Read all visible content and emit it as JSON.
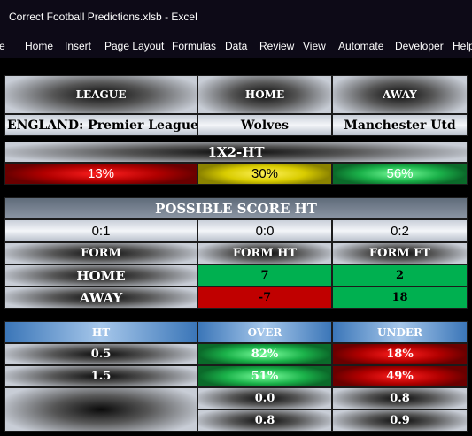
{
  "window": {
    "title": "Correct Football Predictions.xlsb  -  Excel"
  },
  "ribbon": {
    "tabs": [
      "e",
      "Home",
      "Insert",
      "Page Layout",
      "Formulas",
      "Data",
      "Review",
      "View",
      "Automate",
      "Developer",
      "Help"
    ]
  },
  "match": {
    "league_header": "LEAGUE",
    "home_header": "HOME",
    "away_header": "AWAY",
    "league": "ENGLAND: Premier League",
    "home_team": "Wolves",
    "away_team": "Manchester Utd"
  },
  "ht_1x2": {
    "title": "1X2-HT",
    "home_pct": "13%",
    "draw_pct": "30%",
    "away_pct": "56%"
  },
  "score": {
    "title": "POSSIBLE SCORE HT",
    "values": [
      "0:1",
      "0:0",
      "0:2"
    ],
    "form_label": "FORM",
    "form_ht_label": "FORM HT",
    "form_ft_label": "FORM FT",
    "home_label": "HOME",
    "away_label": "AWAY",
    "home_ht": "7",
    "home_ft": "2",
    "away_ht": "-7",
    "away_ft": "18"
  },
  "overunder": {
    "ht_label": "HT",
    "over_label": "OVER",
    "under_label": "UNDER",
    "rows": [
      {
        "line": "0.5",
        "over": "82%",
        "under": "18%"
      },
      {
        "line": "1.5",
        "over": "51%",
        "under": "49%"
      }
    ],
    "extra": [
      [
        "0.0",
        "0.8"
      ],
      [
        "0.8",
        "0.9"
      ]
    ]
  },
  "colors": {
    "red": "#c00000",
    "green": "#00b050",
    "yellow": "#e6d800",
    "blue": "#3b76b8"
  }
}
